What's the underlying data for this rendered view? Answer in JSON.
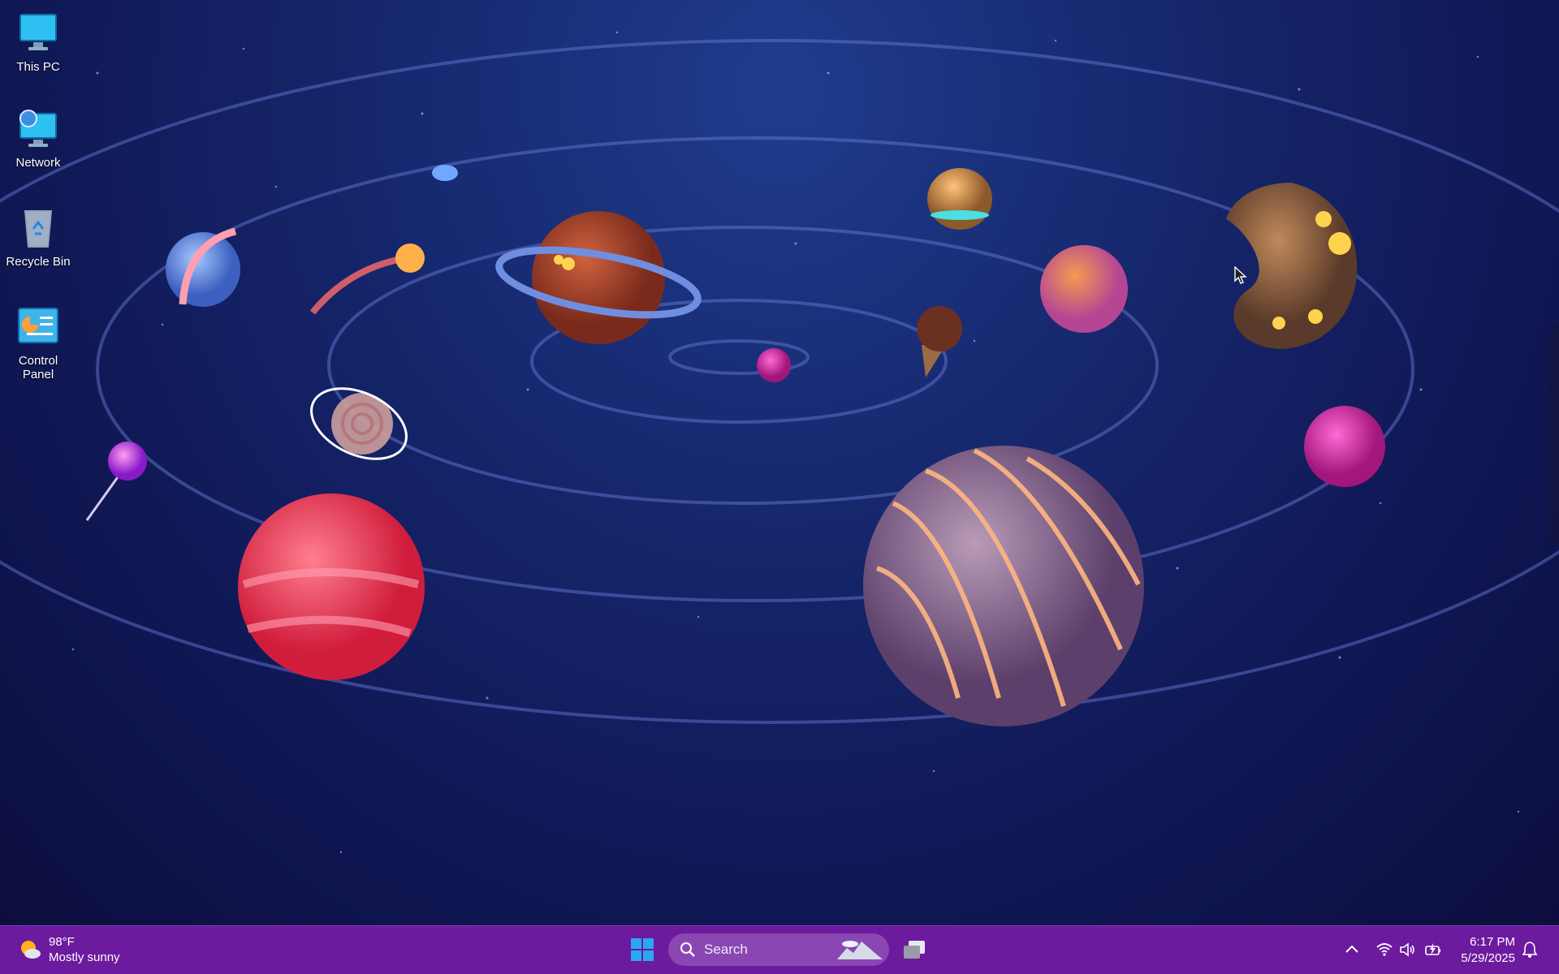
{
  "desktop": {
    "icons": [
      {
        "label": "This PC",
        "icon": "monitor-icon"
      },
      {
        "label": "Network",
        "icon": "network-icon"
      },
      {
        "label": "Recycle Bin",
        "icon": "recycle-bin-icon"
      },
      {
        "label": "Control Panel",
        "icon": "control-panel-icon"
      }
    ],
    "wallpaper": "candy-planets-solar-system"
  },
  "taskbar": {
    "weather": {
      "temp": "98°F",
      "condition": "Mostly sunny",
      "icon": "sun-cloud-icon"
    },
    "start_icon": "windows-logo-icon",
    "search": {
      "placeholder": "Search",
      "icon": "search-icon"
    },
    "taskview_icon": "task-view-icon",
    "tray": {
      "overflow_icon": "chevron-up-icon",
      "wifi_icon": "wifi-icon",
      "volume_icon": "speaker-icon",
      "battery_icon": "battery-charging-icon"
    },
    "clock": {
      "time": "6:17 PM",
      "date": "5/29/2025"
    },
    "notification_icon": "bell-icon"
  },
  "colors": {
    "taskbar_bg": "#6c1a9e",
    "search_bg": "#8a47b3",
    "accent": "#0a84ff"
  }
}
